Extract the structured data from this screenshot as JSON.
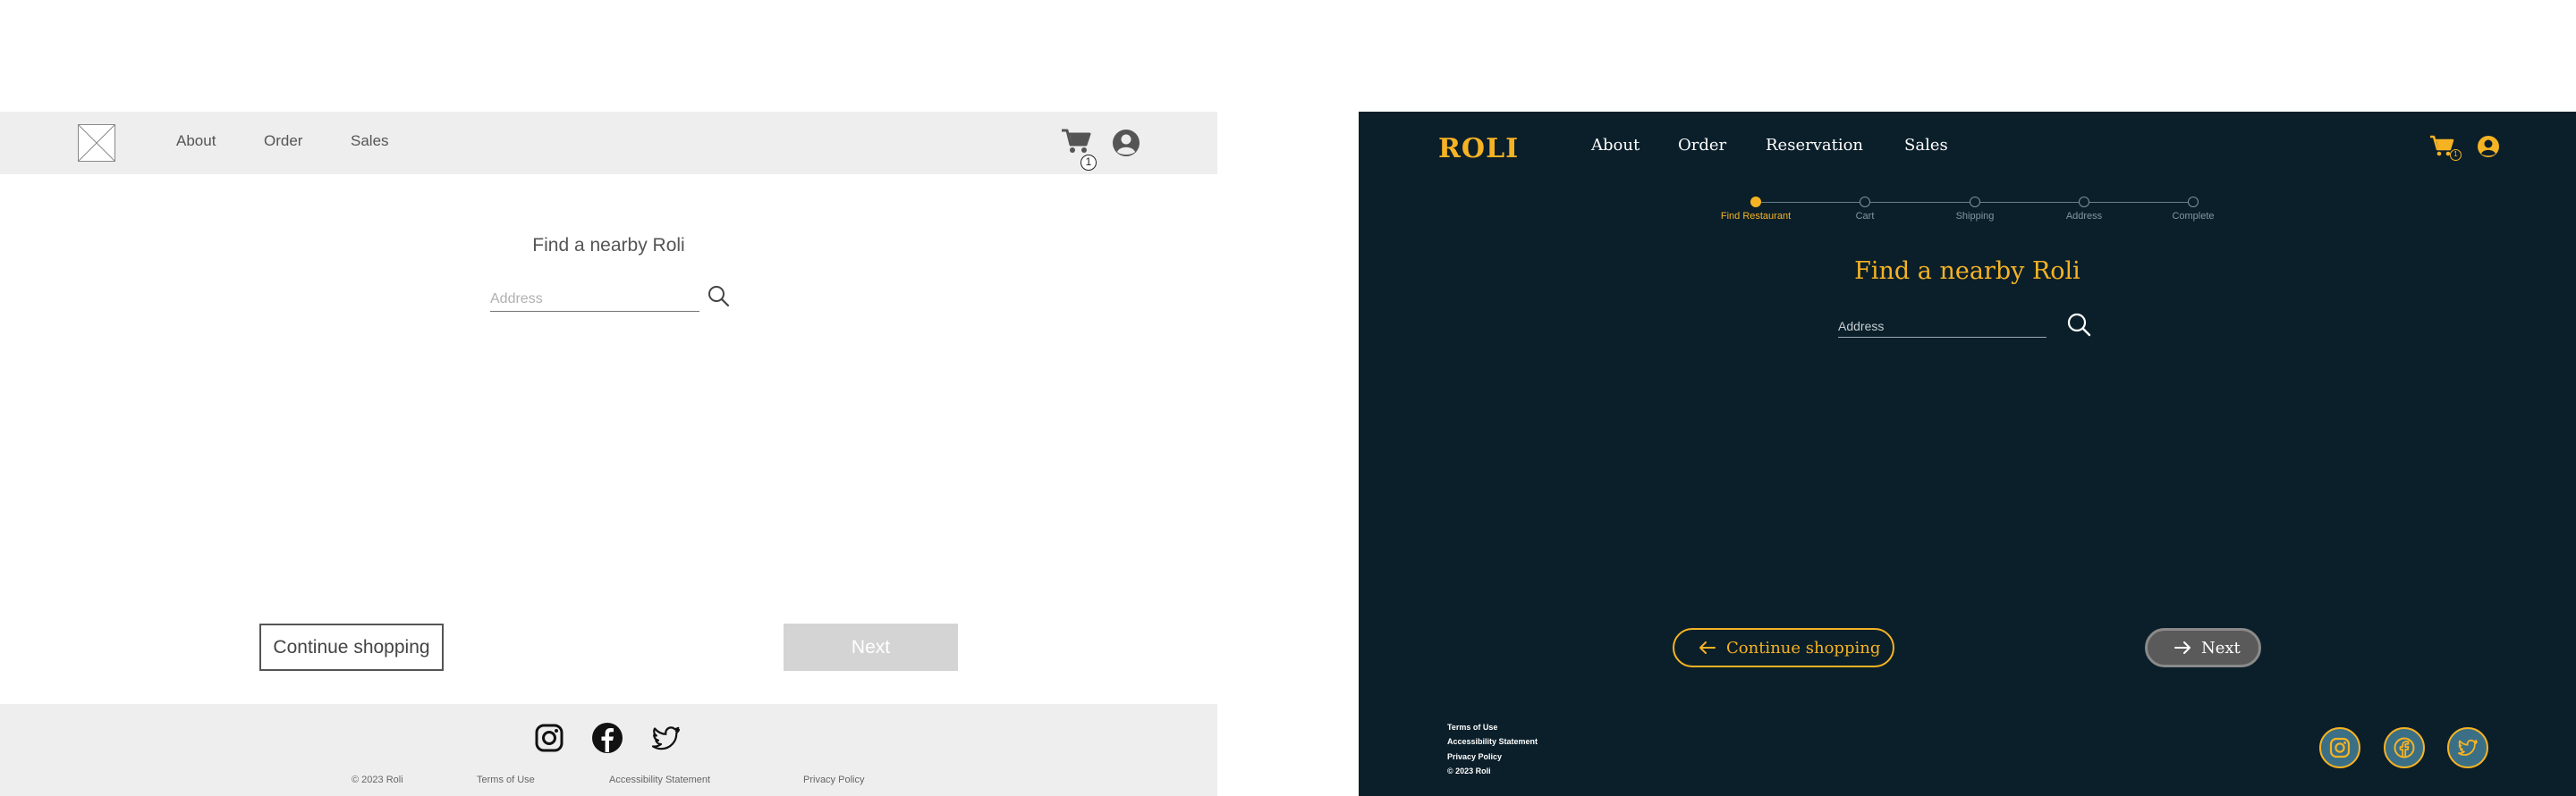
{
  "wireframe": {
    "nav": [
      "About",
      "Order",
      "Sales"
    ],
    "cart_count": "1",
    "title": "Find a nearby Roli",
    "address_placeholder": "Address",
    "continue_label": "Continue shopping",
    "next_label": "Next",
    "footer_links": [
      "© 2023 Roli",
      "Terms of Use",
      "Accessibility Statement",
      "Privacy Policy"
    ],
    "social": [
      "instagram-icon",
      "facebook-icon",
      "twitter-icon"
    ]
  },
  "design": {
    "logo": "ROLI",
    "nav": [
      "About",
      "Order",
      "Reservation",
      "Sales"
    ],
    "cart_count": "1",
    "steps": [
      "Find Restaurant",
      "Cart",
      "Shipping",
      "Address",
      "Complete"
    ],
    "active_step": 0,
    "title": "Find a nearby Roli",
    "address_placeholder": "Address",
    "continue_label": "Continue shopping",
    "next_label": "Next",
    "footer_links": [
      "Terms of Use",
      "Accessibility Statement",
      "Privacy Policy",
      "© 2023 Roli"
    ],
    "social": [
      "instagram-icon",
      "facebook-icon",
      "twitter-icon"
    ],
    "colors": {
      "background": "#0b1f2a",
      "accent": "#f5b324",
      "social_fill": "#3a6f86"
    }
  }
}
